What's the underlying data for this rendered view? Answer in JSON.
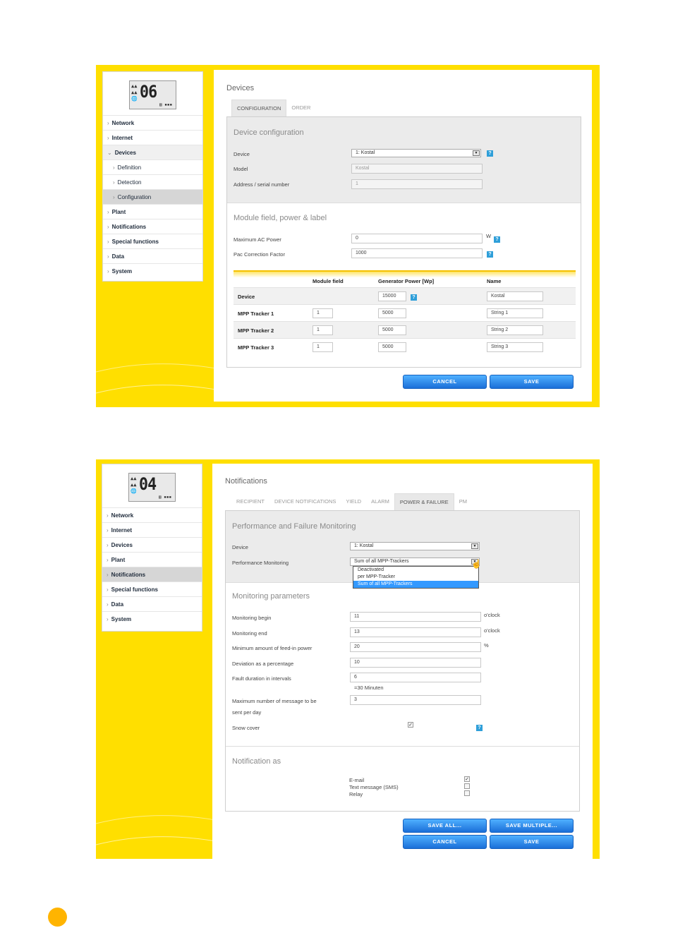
{
  "colors": {
    "frame": "#ffdf00",
    "button": "#1b6fd8",
    "help": "#2f9fd9",
    "page_dot": "#ffb400"
  },
  "nav_sym": "›",
  "shot1": {
    "lcd": {
      "digits": "06",
      "symbols": "▲▲\n▲▲\n🌐",
      "battery": "▤ ▪▪▪"
    },
    "nav": [
      {
        "label": "Network",
        "chev": "›"
      },
      {
        "label": "Internet",
        "chev": "›"
      },
      {
        "label": "Devices",
        "chev": "⌄"
      },
      {
        "label": "Definition",
        "chev": "›"
      },
      {
        "label": "Detection",
        "chev": "›"
      },
      {
        "label": "Configuration",
        "chev": "›"
      },
      {
        "label": "Plant",
        "chev": "›"
      },
      {
        "label": "Notifications",
        "chev": "›"
      },
      {
        "label": "Special functions",
        "chev": "›"
      },
      {
        "label": "Data",
        "chev": "›"
      },
      {
        "label": "System",
        "chev": "›"
      }
    ],
    "title": "Devices",
    "tabs": [
      "CONFIGURATION",
      "ORDER"
    ],
    "sec1": {
      "title": "Device configuration",
      "device_label": "Device",
      "device_value": "1: Kostal",
      "model_label": "Model",
      "model_value": "Kostal",
      "address_label": "Address / serial number",
      "address_value": "1"
    },
    "sec2": {
      "title": "Module field, power & label",
      "max_ac_label": "Maximum AC Power",
      "max_ac_value": "0",
      "max_ac_unit": "W",
      "pac_label": "Pac Correction Factor",
      "pac_value": "1000"
    },
    "table": {
      "headers": [
        "Module field",
        "Generator Power [Wp]",
        "Name"
      ],
      "rows": [
        {
          "label": "Device",
          "module": "",
          "power": "15000",
          "name": "Kostal"
        },
        {
          "label": "MPP Tracker 1",
          "module": "1",
          "power": "5000",
          "name": "String 1"
        },
        {
          "label": "MPP Tracker 2",
          "module": "1",
          "power": "5000",
          "name": "String 2"
        },
        {
          "label": "MPP Tracker 3",
          "module": "1",
          "power": "5000",
          "name": "String 3"
        }
      ]
    },
    "buttons": {
      "cancel": "CANCEL",
      "save": "SAVE"
    },
    "help": "?"
  },
  "shot2": {
    "lcd": {
      "digits": "04",
      "symbols": "▲▲\n▲▲\n🌐",
      "battery": "▤ ▪▪▪"
    },
    "nav": [
      {
        "label": "Network",
        "chev": "›"
      },
      {
        "label": "Internet",
        "chev": "›"
      },
      {
        "label": "Devices",
        "chev": "›"
      },
      {
        "label": "Plant",
        "chev": "›"
      },
      {
        "label": "Notifications",
        "chev": "›"
      },
      {
        "label": "Special functions",
        "chev": "›"
      },
      {
        "label": "Data",
        "chev": "›"
      },
      {
        "label": "System",
        "chev": "›"
      }
    ],
    "title": "Notifications",
    "tabs": [
      "RECIPIENT",
      "DEVICE NOTIFICATIONS",
      "YIELD",
      "ALARM",
      "POWER & FAILURE",
      "PM"
    ],
    "sec1": {
      "title": "Performance and Failure Monitoring",
      "device_label": "Device",
      "device_value": "1: Kostal",
      "perf_label": "Performance Monitoring",
      "perf_value": "Sum of all MPP-Trackers",
      "options": [
        "Deactivated",
        "per MPP-Tracker",
        "Sum of all MPP-Trackers"
      ]
    },
    "sec2": {
      "title": "Monitoring parameters",
      "begin_label": "Monitoring begin",
      "begin_value": "11",
      "begin_unit": "o'clock",
      "end_label": "Monitoring end",
      "end_value": "13",
      "end_unit": "o'clock",
      "min_label": "Minimum amount of feed-in power",
      "min_value": "20",
      "min_unit": "%",
      "dev_label": "Deviation as a percentage",
      "dev_value": "10",
      "fault_label": "Fault duration in intervals",
      "fault_value": "6",
      "fault_note": "=30 Minuten",
      "max_label1": "Maximum number of message to be",
      "max_label2": "sent per day",
      "max_value": "3",
      "snow_label": "Snow cover",
      "snow_checked": "✓"
    },
    "sec3": {
      "title": "Notification as",
      "email": "E-mail",
      "sms": "Text message (SMS)",
      "relay": "Relay",
      "email_checked": "✓"
    },
    "buttons": {
      "save_all": "SAVE ALL...",
      "save_multiple": "SAVE MULTIPLE...",
      "cancel": "CANCEL",
      "save": "SAVE"
    },
    "help": "?"
  }
}
